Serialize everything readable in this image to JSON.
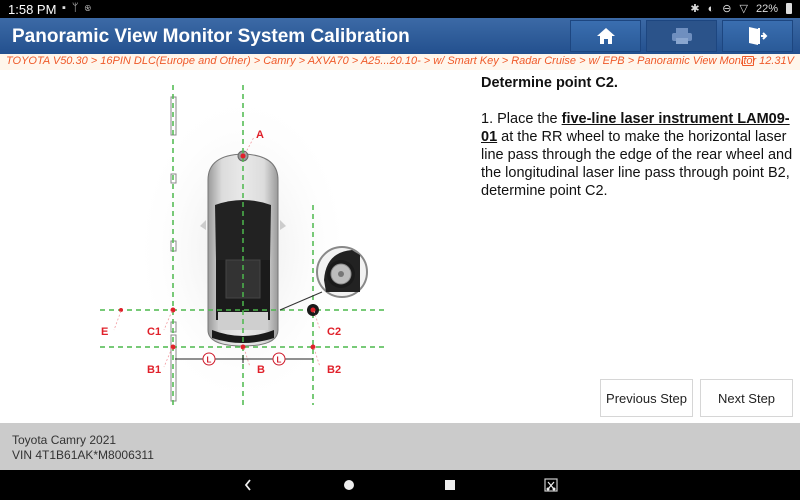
{
  "status_bar": {
    "time": "1:58 PM",
    "left_icons": [
      "image-icon",
      "usb-icon",
      "settings-circle-icon"
    ],
    "right_icons": [
      "bluetooth-icon",
      "vibrate-icon",
      "do-not-disturb-icon",
      "wifi-icon"
    ],
    "battery": "22%"
  },
  "header": {
    "title": "Panoramic View Monitor System Calibration",
    "buttons": [
      {
        "name": "home",
        "icon": "home-icon",
        "enabled": true
      },
      {
        "name": "print",
        "icon": "printer-icon",
        "enabled": false
      },
      {
        "name": "exit",
        "icon": "exit-icon",
        "enabled": true
      }
    ],
    "accent_color": "#2f5d9c"
  },
  "breadcrumb": {
    "path": "TOYOTA V50.30 > 16PIN DLC(Europe and Other) > Camry > AXVA70 > A25...20.10- > w/ Smart Key > Radar Cruise > w/ EPB > Panoramic View Monitor",
    "voltage": "12.31V",
    "color": "#ef5a2a"
  },
  "diagram": {
    "labels": {
      "A": "A",
      "B": "B",
      "B1": "B1",
      "B2": "B2",
      "C1": "C1",
      "C2": "C2",
      "E": "E",
      "L": "L"
    }
  },
  "instructions": {
    "heading": "Determine point C2.",
    "step_prefix": "1. Place the ",
    "step_link": "five-line laser instrument LAM09-01",
    "step_suffix": " at the RR wheel to make the horizontal laser line pass through the edge of the rear wheel and the longitudinal laser line pass through point B2, determine point C2."
  },
  "buttons": {
    "previous": "Previous Step",
    "next": "Next Step"
  },
  "footer": {
    "vehicle": "Toyota Camry 2021",
    "vin": "VIN 4T1B61AK*M8006311"
  },
  "nav_bar": [
    "back-icon",
    "home-circle-icon",
    "recents-icon",
    "screenshot-icon"
  ]
}
